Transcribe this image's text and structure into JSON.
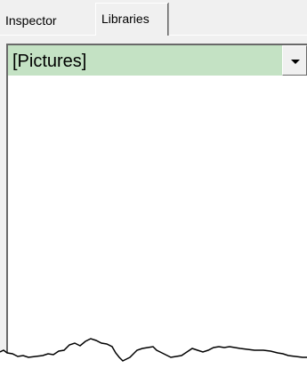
{
  "tabs": [
    {
      "label": "Inspector",
      "active": false
    },
    {
      "label": "Libraries",
      "active": true
    }
  ],
  "library": {
    "selected": "[Pictures]"
  },
  "colors": {
    "dropdown_background": "#c4e2c4",
    "panel_background": "#f0f0f0",
    "list_background": "#ffffff"
  }
}
